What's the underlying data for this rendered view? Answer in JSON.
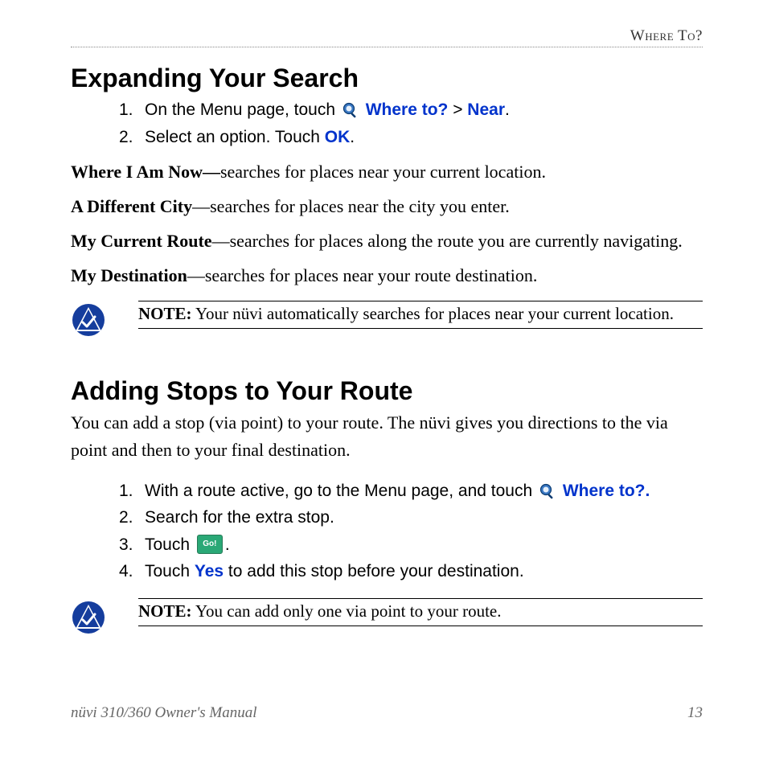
{
  "header": {
    "breadcrumb": "Where To?"
  },
  "section1": {
    "heading": "Expanding Your Search",
    "steps": [
      {
        "num": "1.",
        "pre": "On the Menu page, touch ",
        "ui1": "Where to?",
        "mid": " > ",
        "ui2": "Near",
        "post": "."
      },
      {
        "num": "2.",
        "pre": "Select an option. Touch ",
        "ui1": "OK",
        "post": "."
      }
    ],
    "defs": [
      {
        "term": "Where I Am Now—",
        "desc": "searches for places near your current location."
      },
      {
        "term": "A Different City",
        "dash": "—",
        "desc": "searches for places near the city you enter."
      },
      {
        "term": "My Current Route",
        "dash": "—",
        "desc": "searches for places along the route you are currently navigating."
      },
      {
        "term": "My Destination",
        "dash": "—",
        "desc": "searches for places near your route destination."
      }
    ],
    "note": {
      "label": "NOTE:",
      "text": " Your nüvi automatically searches for places near your current location."
    }
  },
  "section2": {
    "heading": "Adding Stops to Your Route",
    "intro": "You can add a stop (via point) to your route. The nüvi gives you directions to the via point and then to your final destination.",
    "steps": [
      {
        "num": "1.",
        "pre": "With a route active, go to the Menu page, and touch ",
        "ui1": "Where to?."
      },
      {
        "num": "2.",
        "pre": "Search for the extra stop."
      },
      {
        "num": "3.",
        "pre": "Touch ",
        "go": "Go!",
        "post": "."
      },
      {
        "num": "4.",
        "pre": "Touch ",
        "ui1": "Yes",
        "post": " to add this stop before your destination."
      }
    ],
    "note": {
      "label": "NOTE:",
      "text": " You can add only one via point to your route."
    }
  },
  "footer": {
    "manual": "nüvi 310/360 Owner's Manual",
    "page": "13"
  }
}
